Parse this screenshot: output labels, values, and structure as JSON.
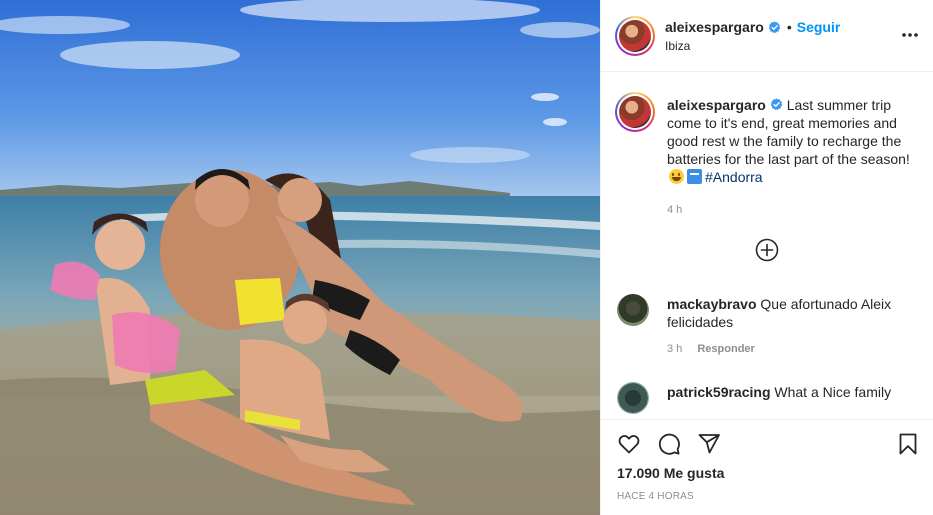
{
  "header": {
    "username": "aleixespargaro",
    "follow_label": "Seguir",
    "location": "Ibiza"
  },
  "caption": {
    "username": "aleixespargaro",
    "text": "Last summer trip come to it's end, great memories and good rest w the family to recharge the batteries for the last part of the season!",
    "emojis": [
      "smiling-face-emoji",
      "soon-arrow-emoji"
    ],
    "hashtag": "#Andorra",
    "time": "4 h"
  },
  "comments": [
    {
      "username": "mackaybravo",
      "text": "Que afortunado Aleix felicidades",
      "time": "3 h",
      "reply_label": "Responder"
    },
    {
      "username": "patrick59racing",
      "text": "What a Nice family"
    }
  ],
  "actions": {
    "likes": "17.090 Me gusta",
    "post_time": "HACE 4 HORAS"
  },
  "colors": {
    "accent": "#0095f6",
    "hashtag": "#00376b",
    "muted": "#8e8e8e",
    "border": "#efefef"
  }
}
